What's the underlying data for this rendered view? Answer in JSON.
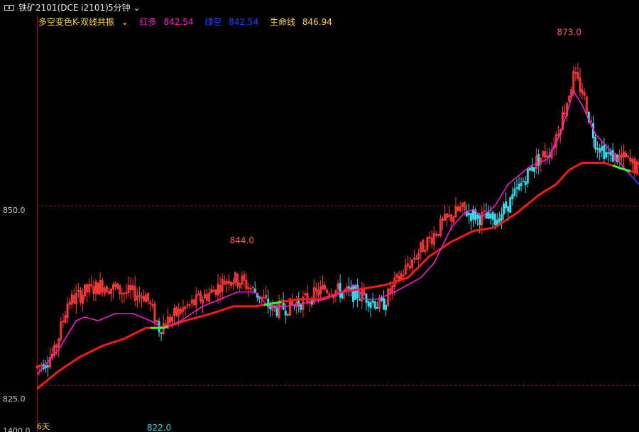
{
  "header": {
    "icon": "window-icon",
    "title": "铁矿2101(DCE i2101)",
    "period": "5分钟"
  },
  "indicator": {
    "name": "多空变色K-双线共振",
    "red_label": "红多",
    "red_value": "842.54",
    "green_label": "绿空",
    "green_value": "842.54",
    "life_label": "生命线",
    "life_value": "846.94"
  },
  "colors": {
    "up": "#ff3b3b",
    "down": "#3ad6e8",
    "magenta": "#ff1fd0",
    "life_red": "#ff1a1a",
    "green": "#33ff33",
    "blue": "#2040ff",
    "ind_name": "#ffd24a",
    "grid": "#8b1a1a"
  },
  "y_axis": {
    "labels": [
      {
        "value": 850,
        "text": "850.0"
      },
      {
        "value": 825,
        "text": "825.0"
      }
    ],
    "cut_label": "1400.0"
  },
  "annotations": {
    "high": "873.0",
    "mid_high": "844.0",
    "low": "822.0",
    "bottom_left": "6天"
  },
  "chart_data": {
    "type": "candlestick",
    "ylim": [
      818.5,
      876.5
    ],
    "price_labels": [
      850,
      825
    ],
    "peaks": [
      {
        "label": "844.0",
        "x_index": 94,
        "value": 844.0
      },
      {
        "label": "873.0",
        "x_index": 244,
        "value": 873.0
      },
      {
        "label": "822.0",
        "x_index": 56,
        "value": 822.0
      }
    ],
    "keypoints": [
      [
        0,
        827.5
      ],
      [
        8,
        829.5
      ],
      [
        14,
        836.5
      ],
      [
        22,
        838
      ],
      [
        30,
        839
      ],
      [
        40,
        838
      ],
      [
        50,
        837.5
      ],
      [
        56,
        833
      ],
      [
        64,
        835
      ],
      [
        72,
        836.5
      ],
      [
        80,
        838
      ],
      [
        88,
        840
      ],
      [
        94,
        839.5
      ],
      [
        102,
        837.5
      ],
      [
        108,
        835.5
      ],
      [
        116,
        836
      ],
      [
        124,
        837
      ],
      [
        132,
        838.5
      ],
      [
        140,
        838
      ],
      [
        150,
        837.5
      ],
      [
        158,
        836
      ],
      [
        166,
        840
      ],
      [
        176,
        844
      ],
      [
        186,
        847.5
      ],
      [
        194,
        849.5
      ],
      [
        202,
        848.5
      ],
      [
        210,
        848
      ],
      [
        218,
        851
      ],
      [
        228,
        856
      ],
      [
        236,
        858
      ],
      [
        242,
        863.5
      ],
      [
        246,
        868
      ],
      [
        250,
        866
      ],
      [
        256,
        859
      ],
      [
        262,
        857
      ],
      [
        270,
        856.5
      ],
      [
        276,
        855
      ]
    ],
    "magenta_points": [
      [
        0,
        826.5
      ],
      [
        10,
        830
      ],
      [
        18,
        834
      ],
      [
        22,
        834.5
      ],
      [
        28,
        834
      ],
      [
        36,
        835
      ],
      [
        44,
        835
      ],
      [
        52,
        834
      ],
      [
        58,
        833
      ],
      [
        66,
        834
      ],
      [
        76,
        836
      ],
      [
        84,
        837
      ],
      [
        92,
        838
      ],
      [
        100,
        838
      ],
      [
        106,
        836
      ],
      [
        114,
        836
      ],
      [
        124,
        836.5
      ],
      [
        132,
        837
      ],
      [
        140,
        838
      ],
      [
        146,
        839
      ],
      [
        150,
        837
      ],
      [
        156,
        837
      ],
      [
        164,
        838
      ],
      [
        170,
        839
      ],
      [
        176,
        840
      ],
      [
        182,
        842
      ],
      [
        190,
        847
      ],
      [
        196,
        849
      ],
      [
        200,
        849.5
      ],
      [
        204,
        848.5
      ],
      [
        210,
        850
      ],
      [
        216,
        853
      ],
      [
        226,
        855.5
      ],
      [
        234,
        856.5
      ],
      [
        240,
        860
      ],
      [
        246,
        866
      ],
      [
        250,
        864
      ],
      [
        256,
        860
      ],
      [
        262,
        858
      ],
      [
        270,
        855
      ],
      [
        276,
        853
      ]
    ],
    "red_points": [
      [
        0,
        824.5
      ],
      [
        10,
        827
      ],
      [
        20,
        829
      ],
      [
        30,
        830.5
      ],
      [
        40,
        831.5
      ],
      [
        50,
        833
      ],
      [
        58,
        833
      ],
      [
        68,
        834
      ],
      [
        80,
        835
      ],
      [
        90,
        836
      ],
      [
        100,
        836
      ],
      [
        110,
        836.5
      ],
      [
        120,
        837
      ],
      [
        130,
        837
      ],
      [
        140,
        838
      ],
      [
        150,
        838.5
      ],
      [
        160,
        839
      ],
      [
        170,
        840
      ],
      [
        180,
        843
      ],
      [
        190,
        845
      ],
      [
        200,
        846.5
      ],
      [
        210,
        847
      ],
      [
        220,
        849
      ],
      [
        230,
        851.5
      ],
      [
        238,
        853
      ],
      [
        244,
        855
      ],
      [
        250,
        856
      ],
      [
        260,
        856
      ],
      [
        270,
        855
      ],
      [
        276,
        854.5
      ]
    ],
    "green_segments": [
      [
        52,
        60
      ],
      [
        104,
        112
      ],
      [
        264,
        272
      ]
    ],
    "blue_segment": [
      272,
      276
    ]
  }
}
